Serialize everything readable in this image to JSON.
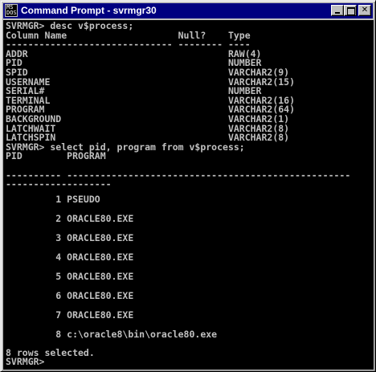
{
  "window": {
    "title": "Command Prompt - svrmgr30",
    "icon_name": "ms-dos-icon",
    "icon_glyph_top": "MS",
    "icon_glyph_bottom": "DOS",
    "buttons": {
      "minimize": "minimize-icon",
      "maximize": "maximize-icon",
      "close": "close-icon",
      "close_glyph": "✕"
    }
  },
  "colors": {
    "titlebar": "#000080",
    "console_bg": "#000000",
    "console_text": "#c0c0c0",
    "chrome": "#c0c0c0"
  },
  "console": {
    "desc_command": "SVRMGR> desc v$process;",
    "desc_header": "Column Name                    Null?    Type",
    "desc_separator": "------------------------------ -------- ----",
    "columns": [
      "ADDR                                    RAW(4)",
      "PID                                     NUMBER",
      "SPID                                    VARCHAR2(9)",
      "USERNAME                                VARCHAR2(15)",
      "SERIAL#                                 NUMBER",
      "TERMINAL                                VARCHAR2(16)",
      "PROGRAM                                 VARCHAR2(64)",
      "BACKGROUND                              VARCHAR2(1)",
      "LATCHWAIT                               VARCHAR2(8)",
      "LATCHSPIN                               VARCHAR2(8)"
    ],
    "select_command": "SVRMGR> select pid, program from v$process;",
    "select_header": "PID        PROGRAM",
    "select_separator_1": "---------- ---------------------------------------------------",
    "select_separator_2": "-------------------",
    "rows": [
      "         1 PSEUDO",
      "         2 ORACLE80.EXE",
      "         3 ORACLE80.EXE",
      "         4 ORACLE80.EXE",
      "         5 ORACLE80.EXE",
      "         6 ORACLE80.EXE",
      "         7 ORACLE80.EXE",
      "         8 c:\\oracle8\\bin\\oracle80.exe"
    ],
    "rows_selected": "8 rows selected.",
    "prompt": "SVRMGR>"
  }
}
